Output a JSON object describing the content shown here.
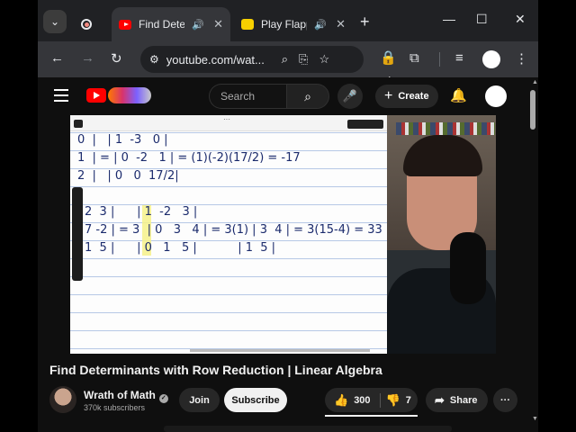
{
  "browser": {
    "tabs": [
      {
        "title": "",
        "kind": "recording"
      },
      {
        "title": "Find Deter",
        "kind": "youtube",
        "audio": true,
        "active": true
      },
      {
        "title": "Play Flapp",
        "kind": "flappy",
        "audio": true,
        "active": false
      }
    ],
    "new_tab": "+",
    "window": {
      "minimize": "—",
      "maximize": "☐",
      "close": "✕"
    },
    "url": "youtube.com/wat..."
  },
  "youtube": {
    "search_placeholder": "Search",
    "create_label": "Create"
  },
  "video": {
    "math_lines": [
      "0  |   | 1  -3   0 |",
      "1  | = | 0  -2   1 | = (1)(-2)(17/2) = -17",
      "2  |   | 0   0  17/2|",
      "2  3 |      | 1  -2   3 |",
      "7 -2 | = 3  | 0   3   4 | = 3(1) | 3  4 | = 3(15-4) = 33",
      "1  5 |      | 0   1   5 |           | 1  5 |"
    ]
  },
  "watch": {
    "title": "Find Determinants with Row Reduction | Linear Algebra",
    "channel_name": "Wrath of Math",
    "subscribers": "370k subscribers",
    "join_label": "Join",
    "subscribe_label": "Subscribe",
    "likes": "300",
    "dislikes": "7",
    "share_label": "Share",
    "more_label": "···"
  },
  "colors": {
    "yt_red": "#ff0000",
    "chrome_dark": "#202124",
    "toolbar": "#35363a",
    "yt_bg": "#0f0f0f",
    "ink": "#1a2a6c"
  }
}
